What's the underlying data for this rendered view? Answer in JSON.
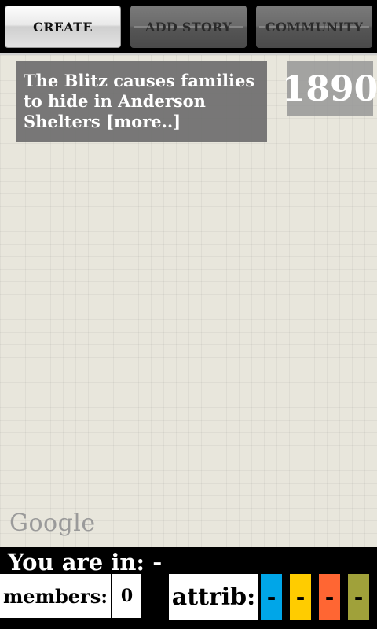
{
  "tabs": [
    {
      "label": "CREATE",
      "active": true
    },
    {
      "label": "ADD STORY",
      "active": false
    },
    {
      "label": "COMMUNITY",
      "active": false
    }
  ],
  "map": {
    "story_text": "The Blitz causes families to hide in Anderson Shelters [more..]",
    "year": "1890",
    "logo_text": "Google"
  },
  "bottom": {
    "you_are_in": "You are in: -",
    "members_label": "members:",
    "members_count": "0",
    "attrib_label": "attrib:",
    "attribs": [
      {
        "value": "-",
        "color": "#00a6e8"
      },
      {
        "value": "-",
        "color": "#ffcc00"
      },
      {
        "value": "-",
        "color": "#ff6633"
      },
      {
        "value": "-",
        "color": "#a0a13a"
      }
    ]
  }
}
